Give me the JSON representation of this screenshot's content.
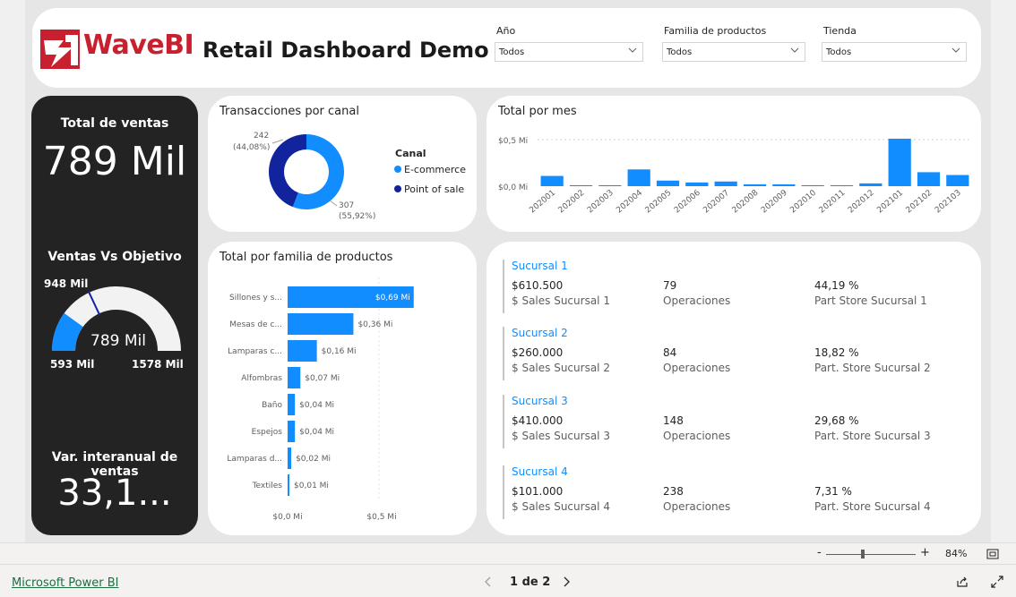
{
  "header": {
    "logo_text": "WaveBI",
    "title": "Retail Dashboard Demo",
    "slicers": [
      {
        "label": "Año",
        "value": "Todos"
      },
      {
        "label": "Familia de productos",
        "value": "Todos"
      },
      {
        "label": "Tienda",
        "value": "Todos"
      }
    ]
  },
  "kpis": {
    "total_ventas_title": "Total de ventas",
    "total_ventas_value": "789 Mil",
    "ventas_vs_objetivo_title": "Ventas Vs Objetivo",
    "gauge": {
      "value_label": "789 Mil",
      "target_label": "948 Mil",
      "min_label": "593 Mil",
      "max_label": "1578 Mil",
      "min": 593,
      "max": 1578,
      "value": 789,
      "target": 948
    },
    "var_interanual_title": "Var. interanual de ventas",
    "var_interanual_value": "33,1..."
  },
  "chart_data": [
    {
      "type": "pie",
      "title": "Transacciones por canal",
      "legend_title": "Canal",
      "categories": [
        "E-commerce",
        "Point of sale"
      ],
      "values": [
        307,
        242
      ],
      "data_labels": [
        "307\n(55,92%)",
        "242\n(44,08%)"
      ],
      "colors": [
        "#118dff",
        "#12239e"
      ],
      "legend_position": "right"
    },
    {
      "type": "bar",
      "title": "Total por mes",
      "categories": [
        "202001",
        "202002",
        "202003",
        "202004",
        "202005",
        "202006",
        "202007",
        "202008",
        "202009",
        "202010",
        "202011",
        "202012",
        "202101",
        "202102",
        "202103"
      ],
      "values": [
        0.11,
        0.01,
        0.01,
        0.18,
        0.06,
        0.04,
        0.05,
        0.02,
        0.02,
        0.01,
        0.005,
        0.03,
        0.51,
        0.15,
        0.12
      ],
      "y_ticks": [
        "$0,0 Mi",
        "$0,5 Mi"
      ],
      "ylim": [
        0,
        0.5
      ],
      "color": "#118dff"
    },
    {
      "type": "bar",
      "orientation": "horizontal",
      "title": "Total por familia de productos",
      "categories": [
        "Sillones y s...",
        "Mesas de c...",
        "Lamparas c...",
        "Alfombras",
        "Baño",
        "Espejos",
        "Lamparas d...",
        "Textiles"
      ],
      "values": [
        0.69,
        0.36,
        0.16,
        0.07,
        0.04,
        0.04,
        0.02,
        0.01
      ],
      "data_labels": [
        "$0,69 Mi",
        "$0,36 Mi",
        "$0,16 Mi",
        "$0,07 Mi",
        "$0,04 Mi",
        "$0,04 Mi",
        "$0,02 Mi",
        "$0,01 Mi"
      ],
      "x_ticks": [
        "$0,0 Mi",
        "$0,5 Mi"
      ],
      "xlim": [
        0,
        0.5
      ],
      "color": "#118dff"
    }
  ],
  "sucursales": [
    {
      "name": "Sucursal 1",
      "sales": "$610.500",
      "sales_label": "$ Sales Sucursal 1",
      "ops": "79",
      "ops_label": "Operaciones",
      "part": "44,19 %",
      "part_label": "Part Store Sucursal 1"
    },
    {
      "name": "Sucursal 2",
      "sales": "$260.000",
      "sales_label": "$ Sales Sucursal 2",
      "ops": "84",
      "ops_label": "Operaciones",
      "part": "18,82 %",
      "part_label": "Part. Store Sucursal 2"
    },
    {
      "name": "Sucursal 3",
      "sales": "$410.000",
      "sales_label": "$ Sales Sucursal 3",
      "ops": "148",
      "ops_label": "Operaciones",
      "part": "29,68 %",
      "part_label": "Part. Store Sucursal 3"
    },
    {
      "name": "Sucursal 4",
      "sales": "$101.000",
      "sales_label": "$ Sales Sucursal 4",
      "ops": "238",
      "ops_label": "Operaciones",
      "part": "7,31 %",
      "part_label": "Part. Store Sucursal 4"
    }
  ],
  "footer": {
    "brand": "Microsoft Power BI",
    "page_indicator": "1 de 2",
    "zoom": "84%"
  }
}
